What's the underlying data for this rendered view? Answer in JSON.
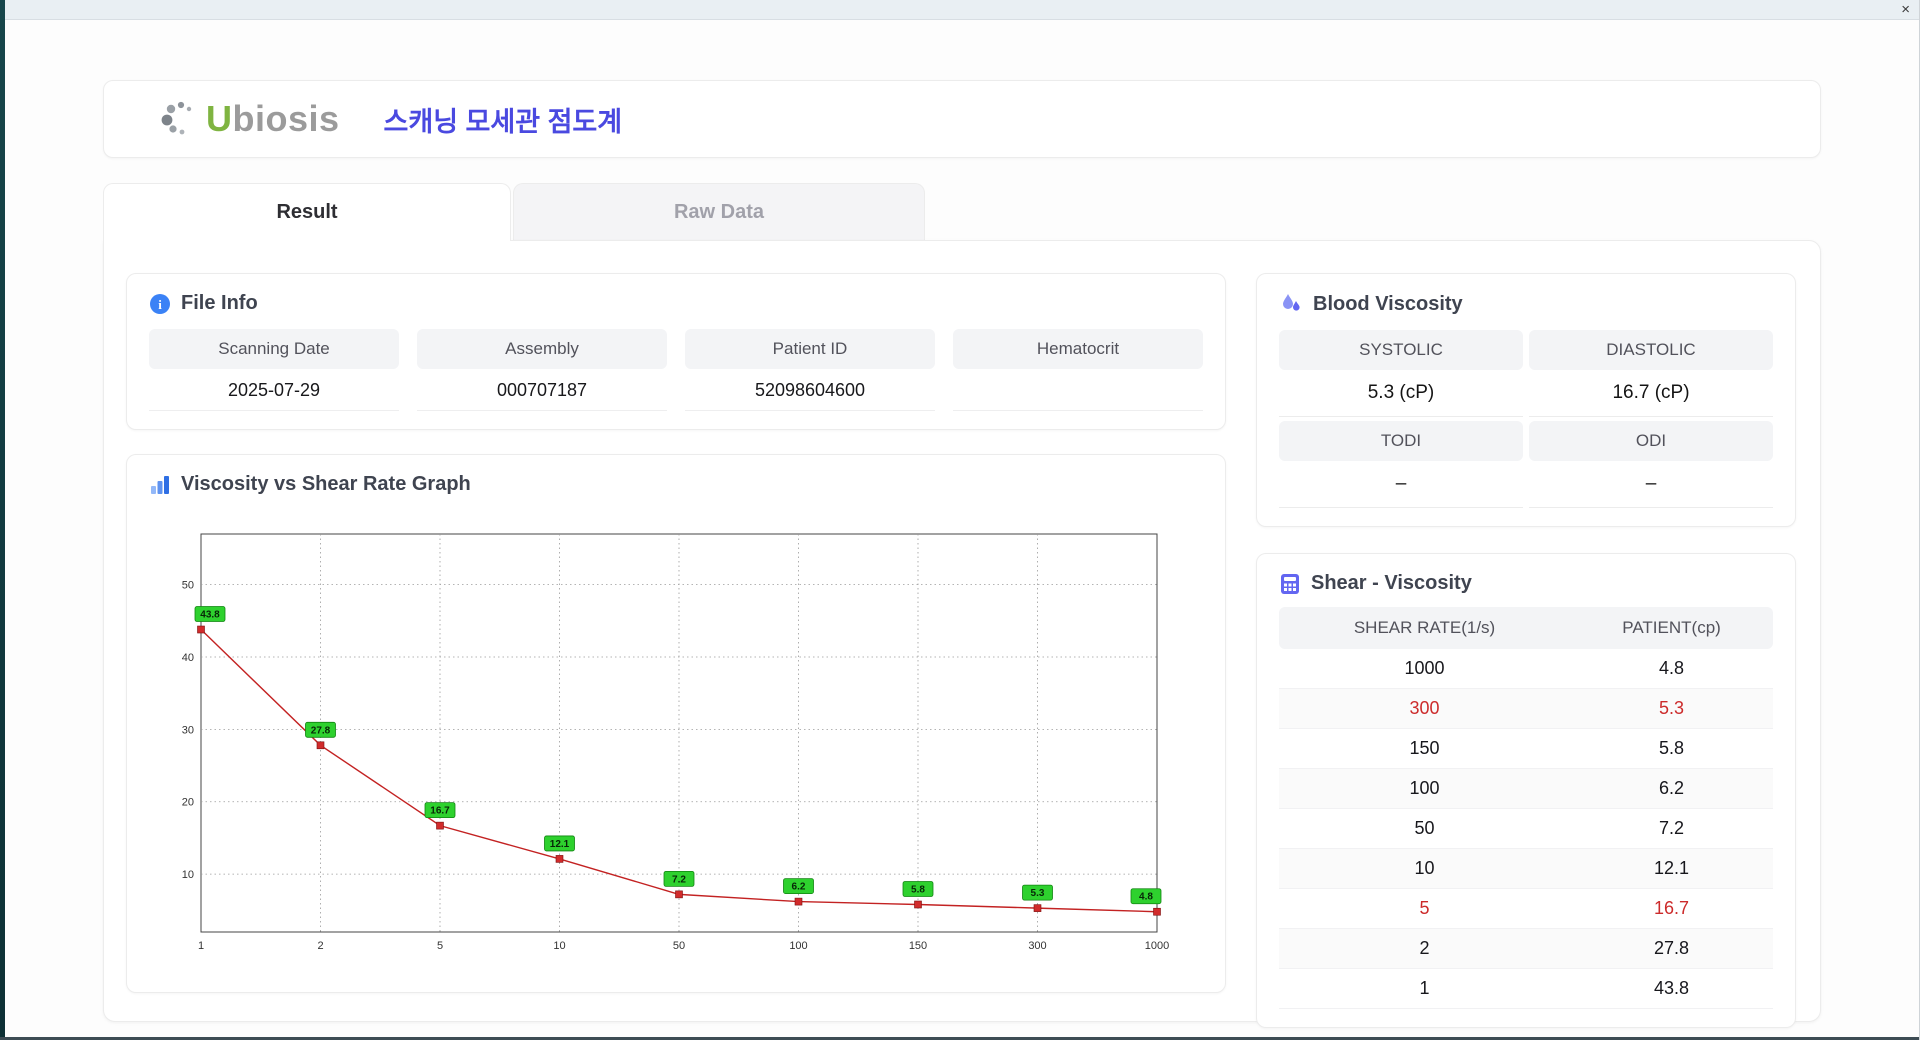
{
  "window": {
    "close_label": "×"
  },
  "header": {
    "logo_u": "U",
    "logo_rest": "biosis",
    "title": "스캐닝 모세관 점도계"
  },
  "tabs": [
    {
      "label": "Result",
      "active": true
    },
    {
      "label": "Raw Data",
      "active": false
    }
  ],
  "icons": {
    "file_info": "info-icon",
    "info_glyph": "i",
    "blood_viscosity": "droplet-icon",
    "graph": "bar-chart-icon",
    "shear": "calculator-icon",
    "close": "close-icon"
  },
  "file_info": {
    "title": "File Info",
    "fields": [
      {
        "label": "Scanning Date",
        "value": "2025-07-29"
      },
      {
        "label": "Assembly",
        "value": "000707187"
      },
      {
        "label": "Patient ID",
        "value": "52098604600"
      },
      {
        "label": "Hematocrit",
        "value": ""
      }
    ]
  },
  "blood_viscosity": {
    "title": "Blood Viscosity",
    "cells": [
      {
        "label": "SYSTOLIC",
        "value": "5.3 (cP)"
      },
      {
        "label": "DIASTOLIC",
        "value": "16.7 (cP)"
      },
      {
        "label": "TODI",
        "value": "–"
      },
      {
        "label": "ODI",
        "value": "–"
      }
    ]
  },
  "shear_viscosity": {
    "title": "Shear - Viscosity",
    "columns": [
      "SHEAR RATE(1/s)",
      "PATIENT(cp)"
    ],
    "rows": [
      {
        "rate": "1000",
        "value": "4.8",
        "highlight": false
      },
      {
        "rate": "300",
        "value": "5.3",
        "highlight": true
      },
      {
        "rate": "150",
        "value": "5.8",
        "highlight": false
      },
      {
        "rate": "100",
        "value": "6.2",
        "highlight": false
      },
      {
        "rate": "50",
        "value": "7.2",
        "highlight": false
      },
      {
        "rate": "10",
        "value": "12.1",
        "highlight": false
      },
      {
        "rate": "5",
        "value": "16.7",
        "highlight": true
      },
      {
        "rate": "2",
        "value": "27.8",
        "highlight": false
      },
      {
        "rate": "1",
        "value": "43.8",
        "highlight": false
      }
    ]
  },
  "chart_data": {
    "type": "line",
    "title": "Viscosity vs Shear Rate Graph",
    "categories": [
      1,
      2,
      5,
      10,
      50,
      100,
      150,
      300,
      1000
    ],
    "values": [
      43.8,
      27.8,
      16.7,
      12.1,
      7.2,
      6.2,
      5.8,
      5.3,
      4.8
    ],
    "xlabel": "",
    "ylabel": "",
    "yticks": [
      10,
      20,
      30,
      40,
      50
    ],
    "ylim": [
      2,
      57
    ],
    "x_axis_type": "categorical",
    "grid": "dotted",
    "line_color": "#c32222",
    "marker_color": "#d12b2b",
    "label_bg": "#2ed12e",
    "label_border": "#118411",
    "legend": "none"
  },
  "colors": {
    "accent_title": "#4a49e0",
    "logo_green": "#7fb441",
    "highlight_red": "#cc2b2b",
    "header_gray": "#f3f4f6",
    "icon_blue": "#3b82f6",
    "icon_indigo": "#6366f1"
  }
}
